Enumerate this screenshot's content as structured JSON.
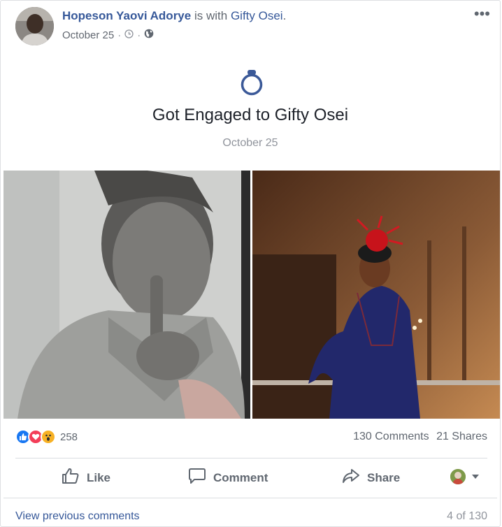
{
  "post": {
    "author": "Hopeson Yaovi Adorye",
    "with_text": "is with",
    "tagged_name": "Gifty Osei",
    "tagged_suffix": ".",
    "date": "October 25",
    "privacy_icon": "globe-icon",
    "time_icon": "clock-icon",
    "more_icon": "more-options-icon"
  },
  "life_event": {
    "icon": "ring-icon",
    "title": "Got Engaged to Gifty Osei",
    "date": "October 25"
  },
  "photos": [
    {
      "name": "portrait-sketch-photo"
    },
    {
      "name": "woman-dress-photo"
    }
  ],
  "reactions": {
    "types": [
      "like",
      "love",
      "wow"
    ],
    "count": "258",
    "colors": {
      "like": "#1877f2",
      "love": "#f33e58",
      "wow": "#f7b125"
    }
  },
  "stats": {
    "comments": "130 Comments",
    "shares": "21 Shares"
  },
  "actions": {
    "like": "Like",
    "comment": "Comment",
    "share": "Share"
  },
  "comments_footer": {
    "view_previous": "View previous comments",
    "pager": "4 of 130"
  },
  "colors": {
    "link": "#365899",
    "muted": "#606770",
    "divider": "#dadde1"
  }
}
